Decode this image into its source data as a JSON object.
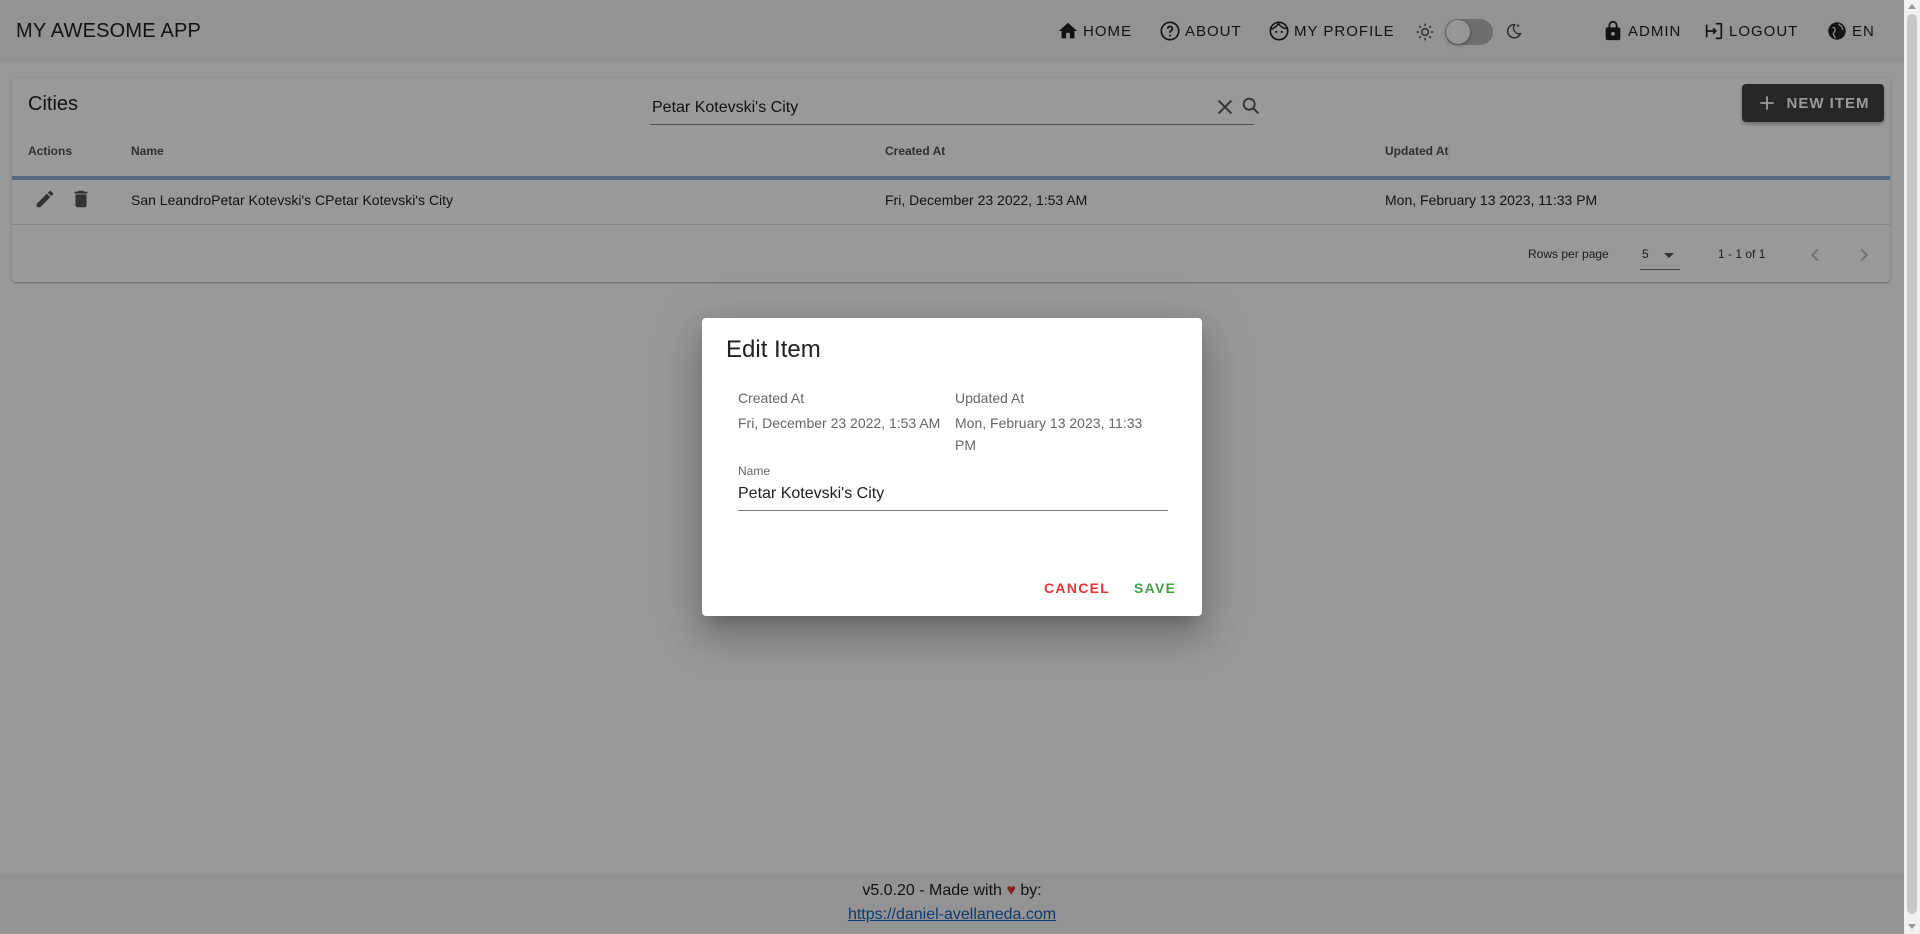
{
  "app": {
    "title": "MY AWESOME APP"
  },
  "nav": {
    "home": "HOME",
    "about": "ABOUT",
    "profile": "MY PROFILE",
    "admin": "ADMIN",
    "logout": "LOGOUT",
    "language": "EN"
  },
  "theme": {
    "dark_mode": false
  },
  "cities": {
    "title": "Cities",
    "search": {
      "value": "Petar Kotevski's City"
    },
    "new_item_label": "NEW ITEM",
    "columns": {
      "actions": "Actions",
      "name": "Name",
      "created": "Created At",
      "updated": "Updated At"
    },
    "rows": [
      {
        "name": "San LeandroPetar Kotevski's CPetar Kotevski's City",
        "created": "Fri, December 23 2022, 1:53 AM",
        "updated": "Mon, February 13 2023, 11:33 PM"
      }
    ],
    "pagination": {
      "rows_per_page_label": "Rows per page",
      "rows_per_page": "5",
      "range": "1 - 1 of 1"
    }
  },
  "footer": {
    "prefix": "v5.0.20 - Made with",
    "suffix": "by:",
    "link": "https://daniel-avellaneda.com"
  },
  "dialog": {
    "title": "Edit Item",
    "created_label": "Created At",
    "created_value": "Fri, December 23 2022, 1:53 AM",
    "updated_label": "Updated At",
    "updated_value": "Mon, February 13 2023, 11:33 PM",
    "name_label": "Name",
    "name_value": "Petar Kotevski's City",
    "cancel_label": "CANCEL",
    "save_label": "SAVE",
    "cancel_color": "#e53935",
    "save_color": "#43a047"
  }
}
